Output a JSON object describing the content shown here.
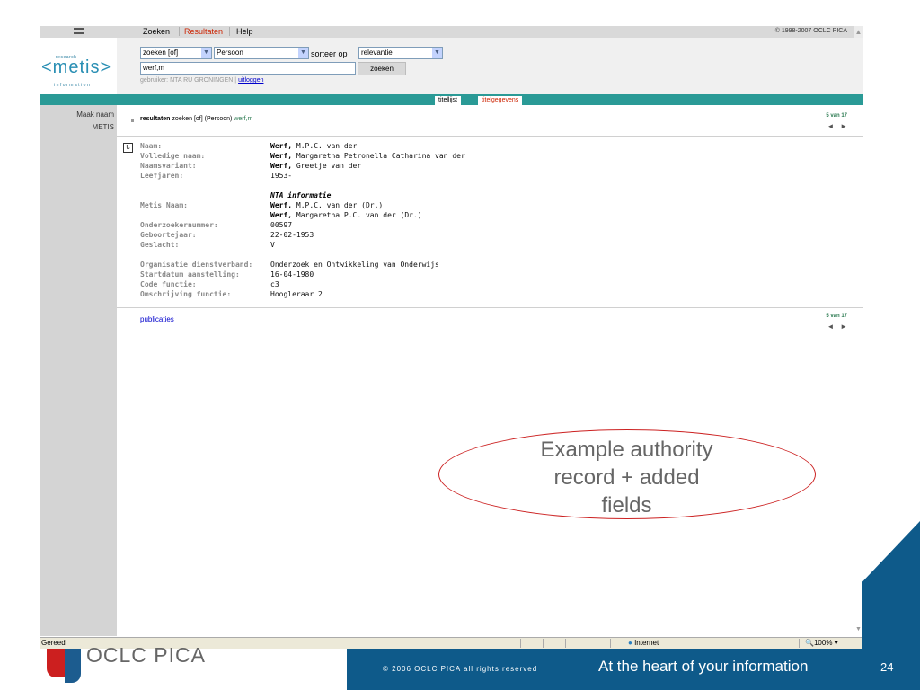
{
  "browser": {
    "tabs": [
      "Zoeken",
      "Resultaten",
      "Help"
    ],
    "active_tab": "Resultaten",
    "copyright": "© 1998-2007 OCLC PICA",
    "status_text": "Gereed",
    "zone": "Internet",
    "zoom": "100%"
  },
  "logo": {
    "small_top": "research",
    "main": "<metis>",
    "small_bottom": "information"
  },
  "search": {
    "operator": "zoeken [of]",
    "index": "Persoon",
    "sort_label": "sorteer op",
    "sort_value": "relevantie",
    "query": "werf,m",
    "button": "zoeken",
    "user_prefix": "gebruiker: NTA RU GRONINGEN |",
    "logout": "uitloggen"
  },
  "view_tabs": [
    "titellijst",
    "titelgegevens"
  ],
  "left_menu": [
    "Maak naam",
    "METIS"
  ],
  "results": {
    "label": "resultaten",
    "query_desc": "zoeken [of] (Persoon)",
    "query_term": "werf,m",
    "count": "5 van 17"
  },
  "record": {
    "fields": [
      {
        "label": "Naam:",
        "value_bold": "Werf,",
        "value": "M.P.C. van der"
      },
      {
        "label": "Volledige naam:",
        "value_bold": "Werf,",
        "value": "Margaretha Petronella Catharina van der"
      },
      {
        "label": "Naamsvariant:",
        "value_bold": "Werf,",
        "value": "Greetje van der"
      },
      {
        "label": "Leefjaren:",
        "value_bold": "",
        "value": "1953-"
      }
    ],
    "nta_heading": "NTA informatie",
    "nta_fields": [
      {
        "label": "Metis Naam:",
        "value_bold": "Werf,",
        "value": "M.P.C. van der (Dr.)"
      },
      {
        "label": "",
        "value_bold": "Werf,",
        "value": "Margaretha P.C. van der (Dr.)"
      },
      {
        "label": "Onderzoekernummer:",
        "value_bold": "",
        "value": "00597"
      },
      {
        "label": "Geboortejaar:",
        "value_bold": "",
        "value": "22-02-1953"
      },
      {
        "label": "Geslacht:",
        "value_bold": "",
        "value": "V"
      }
    ],
    "org_fields": [
      {
        "label": "Organisatie dienstverband:",
        "value": "Onderzoek en Ontwikkeling van Onderwijs"
      },
      {
        "label": "Startdatum aanstelling:",
        "value": "16-04-1980"
      },
      {
        "label": "Code functie:",
        "value": "c3"
      },
      {
        "label": "Omschrijving functie:",
        "value": "Hoogleraar 2"
      }
    ],
    "link": "publicaties"
  },
  "callout": {
    "line1": "Example authority",
    "line2": "record + added",
    "line3": "fields"
  },
  "footer": {
    "brand": "OCLC PICA",
    "copyright": "© 2006 OCLC PICA all rights reserved",
    "tagline": "At the heart of your information",
    "page": "24"
  },
  "colors": {
    "teal": "#2a9a96",
    "brand_blue": "#0e5a8a",
    "accent_red": "#cc2222"
  }
}
